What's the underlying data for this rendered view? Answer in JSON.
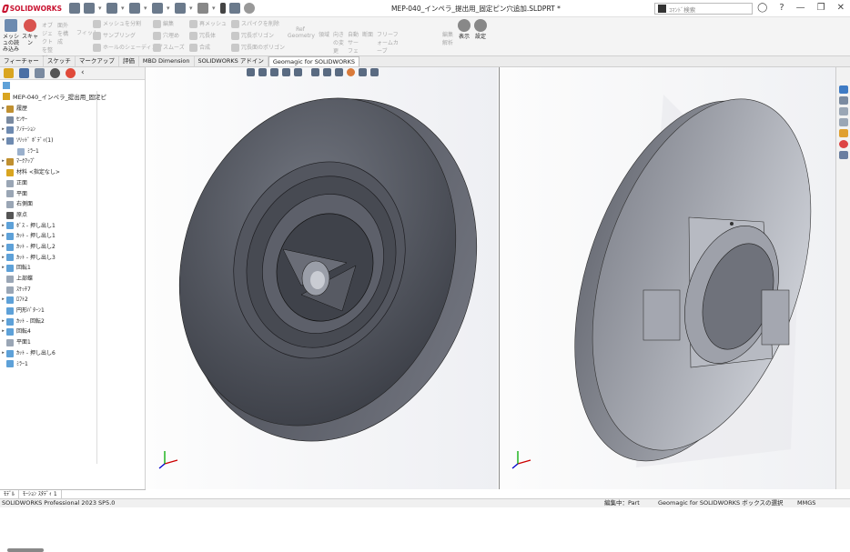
{
  "app": {
    "brand": "SOLIDWORKS",
    "document_title": "MEP-040_インペラ_提出用_固定ピン穴追加.SLDPRT *",
    "search_placeholder": "ｺﾏﾝﾄﾞ検索"
  },
  "ribbon": {
    "buttons": [
      {
        "label": "メッシュの読み込み",
        "icon": "mesh-import-icon"
      },
      {
        "label": "スキャン",
        "icon": "scan-icon"
      }
    ],
    "gray_items": [
      "オブジェクトを整列",
      "面外を構成",
      "フィット",
      "メッシュを分割",
      "サンプリング",
      "ホールのシェーディング",
      "編集",
      "穴埋め",
      "再メッシュ",
      "スムーズ",
      "スパイクを削除",
      "冗長体",
      "冗長ポリゴン",
      "合成",
      "冗長面のポリゴン"
    ],
    "ref_geometry": "Ref Geometry",
    "more": [
      "領域",
      "向きの変更",
      "自動サーフェス",
      "断面",
      "フリーフォームカーブ",
      "編集解析"
    ],
    "display": "表示",
    "settings": "設定"
  },
  "tabs": [
    "フィーチャー",
    "スケッチ",
    "マークアップ",
    "評価",
    "MBD Dimension",
    "SOLIDWORKS アドイン",
    "Geomagic for SOLIDWORKS"
  ],
  "active_tab": "Geomagic for SOLIDWORKS",
  "tree": {
    "root": "MEP-040_インペラ_提出用_固定ピ",
    "items": [
      {
        "label": "履歴",
        "exp": "▸"
      },
      {
        "label": "ｾﾝｻｰ",
        "exp": ""
      },
      {
        "label": "ｱﾉﾃｰｼｮﾝ",
        "exp": "▸"
      },
      {
        "label": "ｿﾘｯﾄﾞ ﾎﾞﾃﾞｨ(1)",
        "exp": "▾"
      },
      {
        "label": "ﾐﾗｰ1",
        "exp": "",
        "indent": true
      },
      {
        "label": "ﾏｰｸｱｯﾌﾟ",
        "exp": "▸"
      },
      {
        "label": "材料 <指定なし>",
        "exp": ""
      },
      {
        "label": "正面",
        "exp": ""
      },
      {
        "label": "平面",
        "exp": ""
      },
      {
        "label": "右側面",
        "exp": ""
      },
      {
        "label": "原点",
        "exp": ""
      },
      {
        "label": "ﾎﾞｽ - 押し出し1",
        "exp": "▸"
      },
      {
        "label": "ｶｯﾄ - 押し出し1",
        "exp": "▸"
      },
      {
        "label": "ｶｯﾄ - 押し出し2",
        "exp": "▸"
      },
      {
        "label": "ｶｯﾄ - 押し出し3",
        "exp": "▸"
      },
      {
        "label": "回転1",
        "exp": "▸"
      },
      {
        "label": "上部蝶",
        "exp": ""
      },
      {
        "label": "ｽｹｯﾁ7",
        "exp": ""
      },
      {
        "label": "ﾛﾌﾄ2",
        "exp": "▸"
      },
      {
        "label": "円形ﾊﾟﾀｰﾝ1",
        "exp": ""
      },
      {
        "label": "ｶｯﾄ - 回転2",
        "exp": "▸"
      },
      {
        "label": "回転4",
        "exp": "▸"
      },
      {
        "label": "平面1",
        "exp": ""
      },
      {
        "label": "ｶｯﾄ - 押し出し6",
        "exp": "▸"
      },
      {
        "label": "ﾐﾗｰ1",
        "exp": ""
      }
    ]
  },
  "bottom_tabs": [
    "ﾓﾃﾞﾙ",
    "ﾓｰｼｮﾝ ｽﾀﾃﾞｨ 1"
  ],
  "status": {
    "left": "SOLIDWORKS Professional 2023 SP5.0",
    "mid1": "編集中：Part",
    "mid2": "Geomagic for SOLIDWORKS ボックスの選択",
    "right": "MMGS"
  },
  "colors": {
    "accent": "#c8102e",
    "part": "#5c5f69"
  }
}
